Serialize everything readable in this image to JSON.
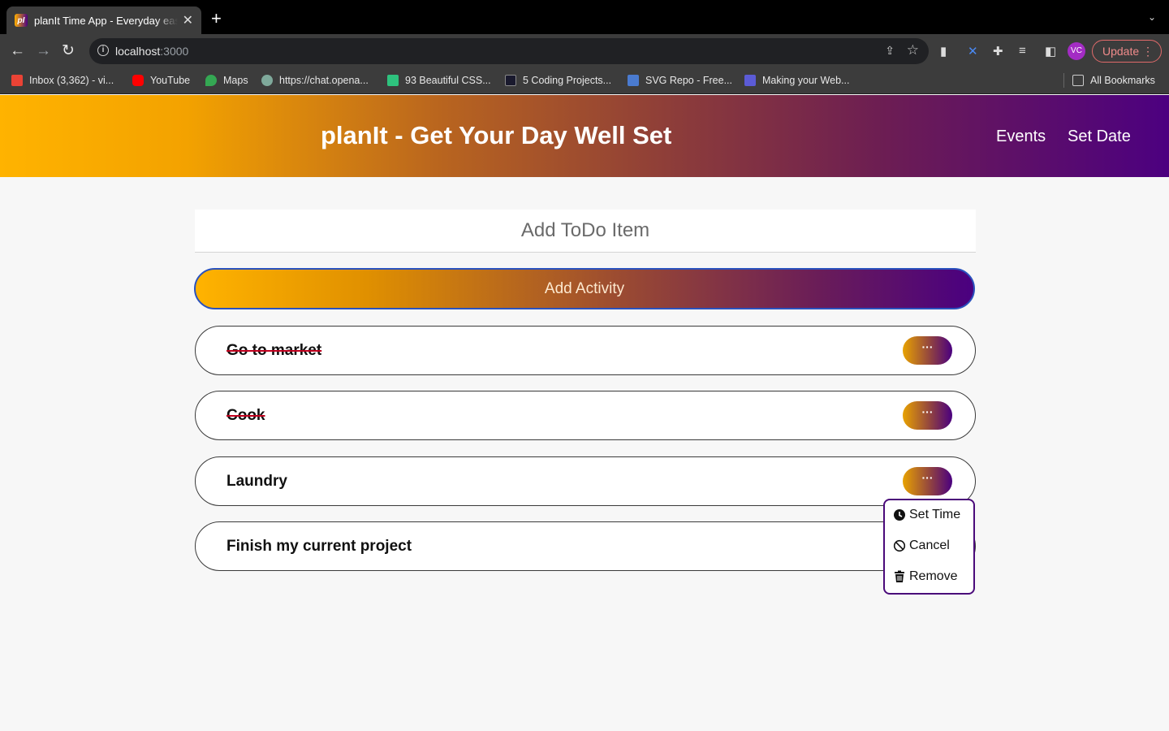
{
  "browser": {
    "tab_title": "planIt Time App - Everyday easy",
    "tab_favicon_text": "pI",
    "url_host": "localhost",
    "url_port": ":3000",
    "avatar_initials": "VC",
    "update_label": "Update",
    "bookmarks": [
      {
        "label": "Inbox (3,362) - vi...",
        "icon": "gmail-icon",
        "color": "#ea4335"
      },
      {
        "label": "YouTube",
        "icon": "youtube-icon",
        "color": "#ff0000"
      },
      {
        "label": "Maps",
        "icon": "maps-icon",
        "color": "#34a853"
      },
      {
        "label": "https://chat.opena...",
        "icon": "openai-icon",
        "color": "#7fa99b"
      },
      {
        "label": "93 Beautiful CSS...",
        "icon": "css-icon",
        "color": "#2ec27e"
      },
      {
        "label": "5 Coding Projects...",
        "icon": "angular-icon",
        "color": "#1a1a2e"
      },
      {
        "label": "SVG Repo - Free...",
        "icon": "svgrepo-icon",
        "color": "#4a7bd0"
      },
      {
        "label": "Making your Web...",
        "icon": "play-icon",
        "color": "#5b5bd6"
      }
    ],
    "all_bookmarks_label": "All Bookmarks"
  },
  "header": {
    "title": "planIt - Get Your Day Well Set",
    "nav": [
      "Events",
      "Set Date"
    ]
  },
  "add": {
    "placeholder": "Add ToDo Item",
    "button_label": "Add Activity"
  },
  "todos": [
    {
      "text": "Go to market",
      "done": true,
      "more_label": "···"
    },
    {
      "text": "Cook",
      "done": true,
      "more_label": "···"
    },
    {
      "text": "Laundry",
      "done": false,
      "more_label": "···"
    },
    {
      "text": "Finish my current project",
      "done": false,
      "more_label": "···"
    }
  ],
  "menu": {
    "items": [
      {
        "label": "Set Time",
        "icon": "clock-icon"
      },
      {
        "label": "Cancel",
        "icon": "ban-icon"
      },
      {
        "label": "Remove",
        "icon": "trash-icon"
      }
    ]
  },
  "colors": {
    "gradient_start": "#ffb300",
    "gradient_end": "#4c0080",
    "strike": "#c0001e"
  }
}
